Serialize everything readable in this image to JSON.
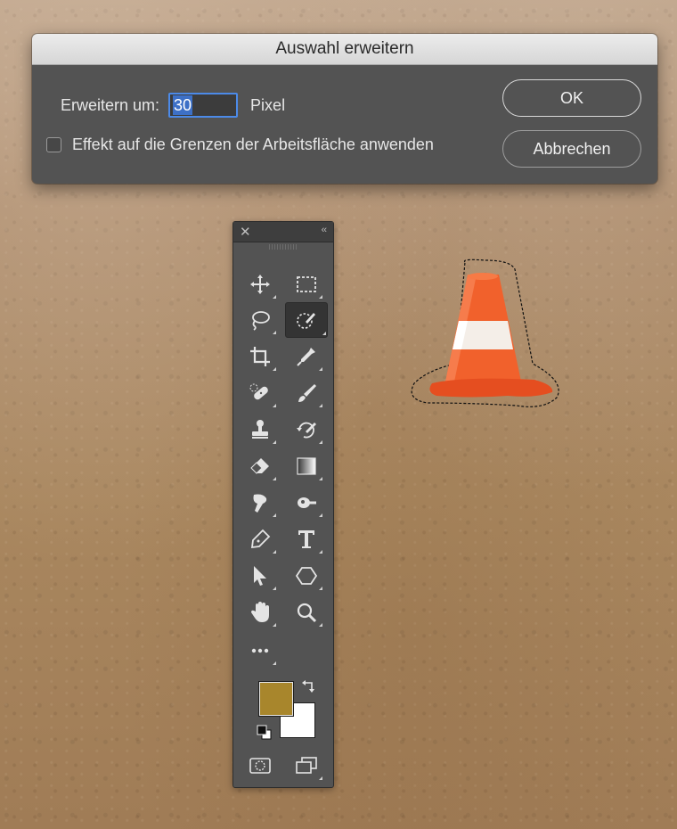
{
  "dialog": {
    "title": "Auswahl erweitern",
    "expand_label": "Erweitern um:",
    "expand_value": "30",
    "unit": "Pixel",
    "checkbox_label": "Effekt auf die Grenzen der Arbeitsfläche anwenden",
    "checkbox_checked": false,
    "ok_label": "OK",
    "cancel_label": "Abbrechen"
  },
  "toolbar": {
    "tools": [
      {
        "name": "move-tool",
        "icon": "move-icon"
      },
      {
        "name": "rectangular-marquee-tool",
        "icon": "marquee-icon"
      },
      {
        "name": "lasso-tool",
        "icon": "lasso-icon"
      },
      {
        "name": "quick-selection-tool",
        "icon": "quick-selection-icon",
        "active": true
      },
      {
        "name": "crop-tool",
        "icon": "crop-icon"
      },
      {
        "name": "eyedropper-tool",
        "icon": "eyedropper-icon"
      },
      {
        "name": "spot-healing-tool",
        "icon": "bandage-icon"
      },
      {
        "name": "brush-tool",
        "icon": "brush-icon"
      },
      {
        "name": "clone-stamp-tool",
        "icon": "stamp-icon"
      },
      {
        "name": "history-brush-tool",
        "icon": "history-brush-icon"
      },
      {
        "name": "eraser-tool",
        "icon": "eraser-icon"
      },
      {
        "name": "gradient-tool",
        "icon": "gradient-icon"
      },
      {
        "name": "smudge-tool",
        "icon": "smudge-icon"
      },
      {
        "name": "dodge-tool",
        "icon": "dodge-icon"
      },
      {
        "name": "pen-tool",
        "icon": "pen-icon"
      },
      {
        "name": "type-tool",
        "icon": "type-icon"
      },
      {
        "name": "path-selection-tool",
        "icon": "arrow-icon"
      },
      {
        "name": "shape-tool",
        "icon": "hexagon-icon"
      },
      {
        "name": "hand-tool",
        "icon": "hand-icon"
      },
      {
        "name": "zoom-tool",
        "icon": "magnifier-icon"
      },
      {
        "name": "edit-toolbar",
        "icon": "more-icon"
      }
    ],
    "foreground_color": "#a8862c",
    "background_color": "#ffffff"
  }
}
